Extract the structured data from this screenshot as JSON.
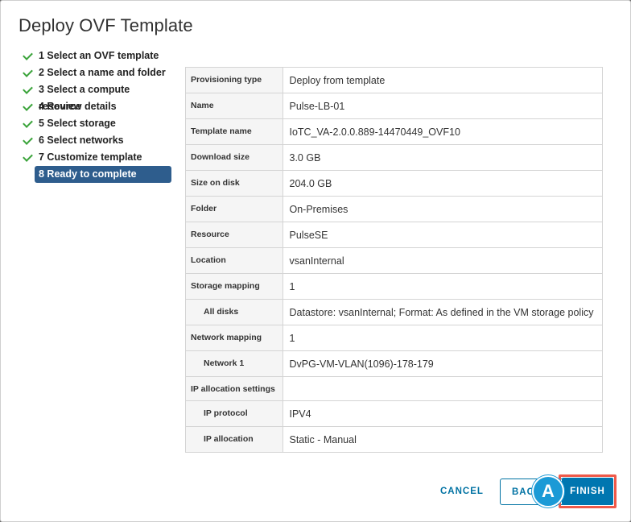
{
  "dialog": {
    "title": "Deploy OVF Template"
  },
  "steps": [
    {
      "label": "1 Select an OVF template",
      "done": true
    },
    {
      "label": "2 Select a name and folder",
      "done": true
    },
    {
      "label": "3 Select a compute resource",
      "done": true
    },
    {
      "label": "4 Review details",
      "done": true
    },
    {
      "label": "5 Select storage",
      "done": true
    },
    {
      "label": "6 Select networks",
      "done": true
    },
    {
      "label": "7 Customize template",
      "done": true
    },
    {
      "label": "8 Ready to complete",
      "done": false,
      "active": true
    }
  ],
  "summary": [
    {
      "key": "Provisioning type",
      "value": "Deploy from template"
    },
    {
      "key": "Name",
      "value": "Pulse-LB-01"
    },
    {
      "key": "Template name",
      "value": "IoTC_VA-2.0.0.889-14470449_OVF10"
    },
    {
      "key": "Download size",
      "value": "3.0 GB"
    },
    {
      "key": "Size on disk",
      "value": "204.0 GB"
    },
    {
      "key": "Folder",
      "value": "On-Premises"
    },
    {
      "key": "Resource",
      "value": "PulseSE"
    },
    {
      "key": "Location",
      "value": "vsanInternal"
    },
    {
      "key": "Storage mapping",
      "value": "1"
    },
    {
      "key": "All disks",
      "value": "Datastore: vsanInternal; Format: As defined in the VM storage policy",
      "sub": true
    },
    {
      "key": "Network mapping",
      "value": "1"
    },
    {
      "key": "Network 1",
      "value": "DvPG-VM-VLAN(1096)-178-179",
      "sub": true
    },
    {
      "key": "IP allocation settings",
      "value": ""
    },
    {
      "key": "IP protocol",
      "value": "IPV4",
      "sub": true
    },
    {
      "key": "IP allocation",
      "value": "Static - Manual",
      "sub": true
    }
  ],
  "footer": {
    "cancel_label": "CANCEL",
    "back_label": "BACK",
    "finish_label": "FINISH"
  },
  "annotation": {
    "marker_label": "A"
  },
  "colors": {
    "accent": "#0072a3",
    "active_step": "#2e5d8d",
    "check": "#3aa33a",
    "highlight": "#ef5a4a",
    "marker": "#1b9ad6"
  }
}
